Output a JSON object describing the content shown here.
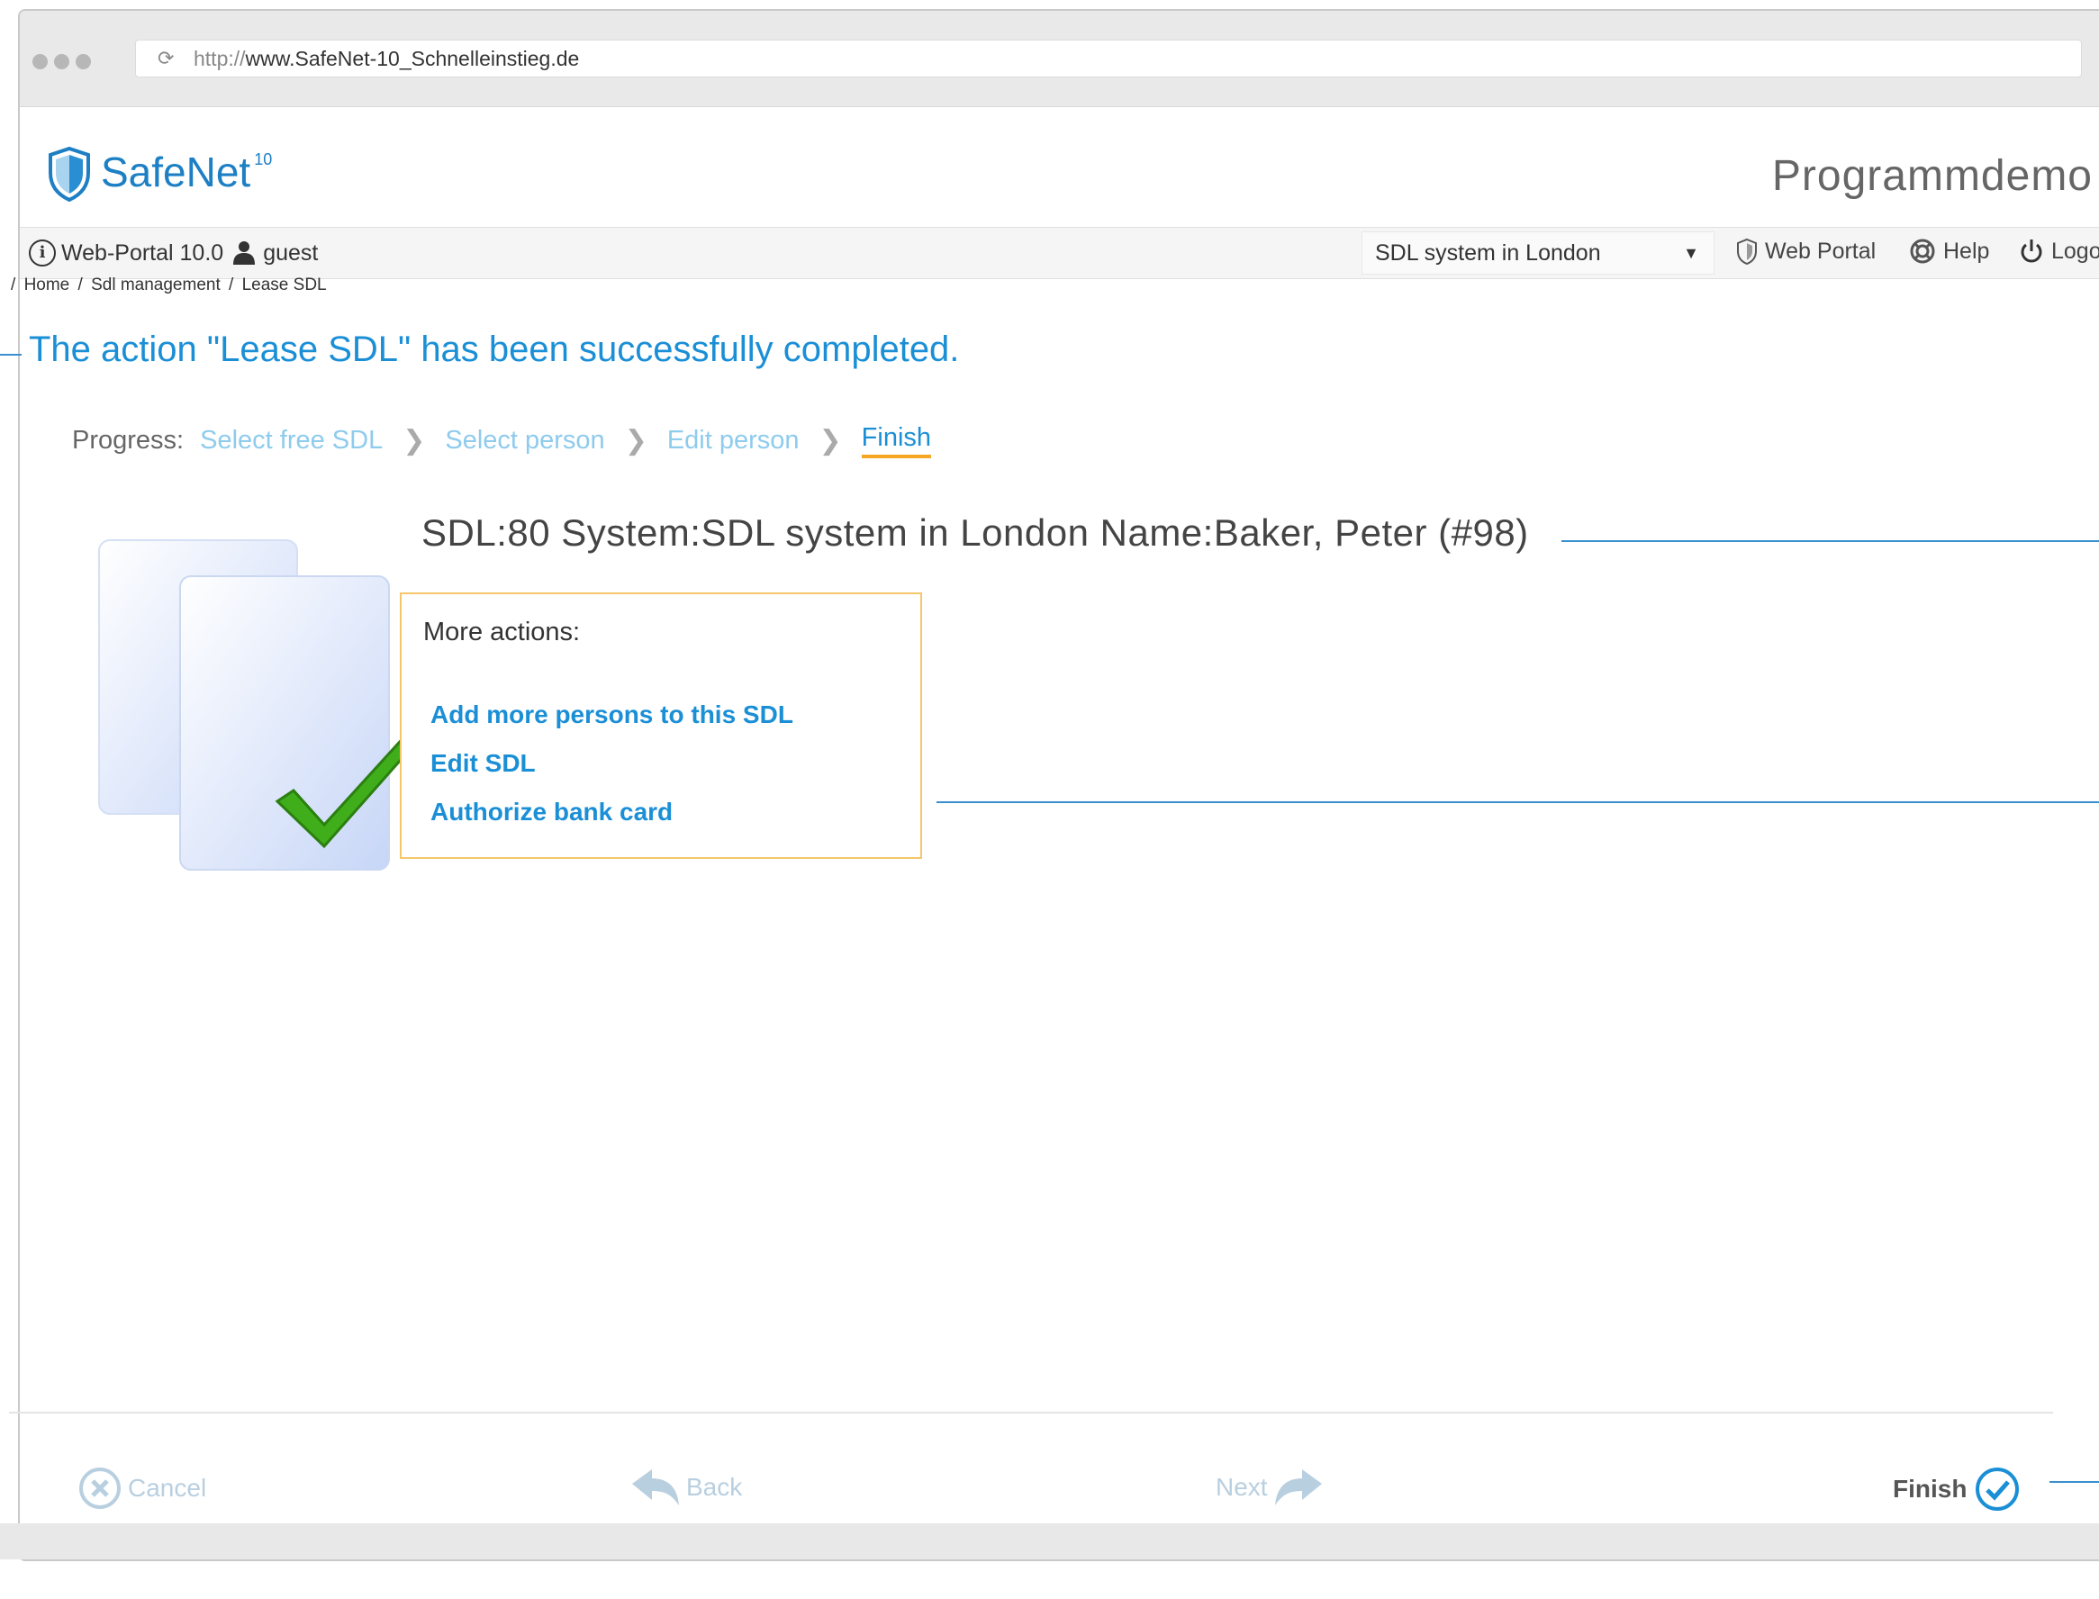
{
  "browser": {
    "url_prefix": "http://",
    "url_host": "www.SafeNet-10_Schnelleinstieg.de"
  },
  "header": {
    "brand": "SafeNet",
    "brand_sup": "10",
    "title": "Programmdemo"
  },
  "toolbar": {
    "portal_version": "Web-Portal 10.0",
    "user": "guest",
    "system_selected": "SDL system in London",
    "web_portal_label": "Web Portal",
    "help_label": "Help",
    "logoff_label": "Logoff"
  },
  "breadcrumb": {
    "sep": "/",
    "items": [
      "Home",
      "Sdl management",
      "Lease SDL"
    ]
  },
  "main": {
    "success_message": "The action \"Lease SDL\" has been successfully completed.",
    "sdl_info": "SDL:80 System:SDL system in London Name:Baker, Peter (#98)"
  },
  "progress": {
    "label": "Progress:",
    "steps": [
      "Select free SDL",
      "Select person",
      "Edit person",
      "Finish"
    ],
    "current_step": "Finish"
  },
  "more_actions": {
    "title": "More actions:",
    "links": [
      "Add more persons to this SDL",
      "Edit SDL",
      "Authorize bank card"
    ]
  },
  "footer": {
    "cancel": "Cancel",
    "back": "Back",
    "next": "Next",
    "finish": "Finish"
  },
  "colors": {
    "accent": "#1b8fd6",
    "step_inactive": "#8ecbed",
    "step_underline": "#f5a623",
    "actions_border": "#f5c76a",
    "check_green": "#3fae1a"
  }
}
